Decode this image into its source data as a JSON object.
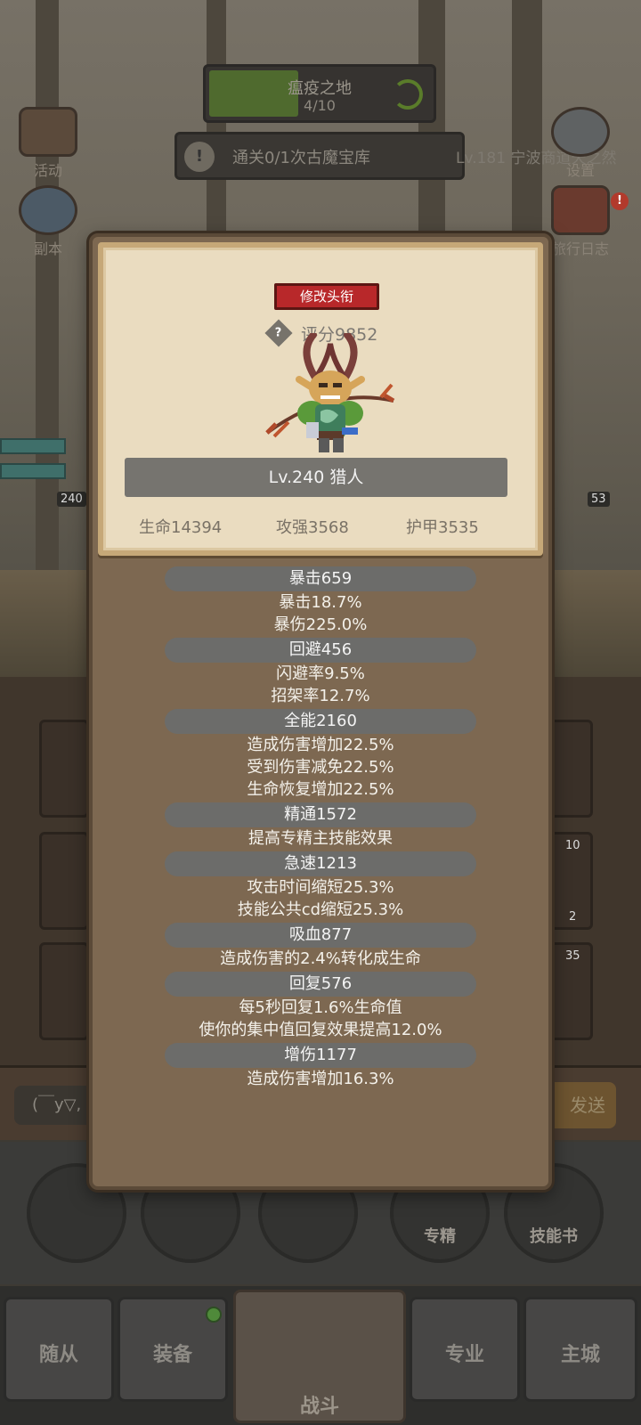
{
  "stage": {
    "name": "瘟疫之地",
    "progress": "4/10"
  },
  "quest": {
    "text": "通关0/1次古魔宝库",
    "alert": "!"
  },
  "ticker": "Lv.181 宁波商道天之然",
  "side_buttons": {
    "activity": "活动",
    "dungeon": "副本",
    "settings": "设置",
    "travel_log": "旅行日志"
  },
  "levels": {
    "left": "240",
    "right": "53"
  },
  "card_counts": {
    "a": "10",
    "b": "2",
    "c": "35"
  },
  "chat": {
    "input": "(￣y▽,",
    "send": "发送"
  },
  "actions": {
    "specialization": "专精",
    "skill_book": "技能书"
  },
  "tabs": {
    "follower": "随从",
    "equipment": "装备",
    "battle": "战斗",
    "profession": "专业",
    "city": "主城"
  },
  "profile": {
    "change_title": "修改头衔",
    "help_icon": "?",
    "score": "评分9852",
    "level_class": "Lv.240 猎人",
    "hp": "生命14394",
    "attack": "攻强3568",
    "armor": "护甲3535"
  },
  "stats": [
    {
      "header": "暴击659",
      "lines": [
        "暴击18.7%",
        "暴伤225.0%"
      ]
    },
    {
      "header": "回避456",
      "lines": [
        "闪避率9.5%",
        "招架率12.7%"
      ]
    },
    {
      "header": "全能2160",
      "lines": [
        "造成伤害增加22.5%",
        "受到伤害减免22.5%",
        "生命恢复增加22.5%"
      ]
    },
    {
      "header": "精通1572",
      "lines": [
        "提高专精主技能效果"
      ]
    },
    {
      "header": "急速1213",
      "lines": [
        "攻击时间缩短25.3%",
        "技能公共cd缩短25.3%"
      ]
    },
    {
      "header": "吸血877",
      "lines": [
        "造成伤害的2.4%转化成生命"
      ]
    },
    {
      "header": "回复576",
      "lines": [
        "每5秒回复1.6%生命值",
        "使你的集中值回复效果提高12.0%"
      ]
    },
    {
      "header": "增伤1177",
      "lines": [
        "造成伤害增加16.3%"
      ]
    }
  ]
}
